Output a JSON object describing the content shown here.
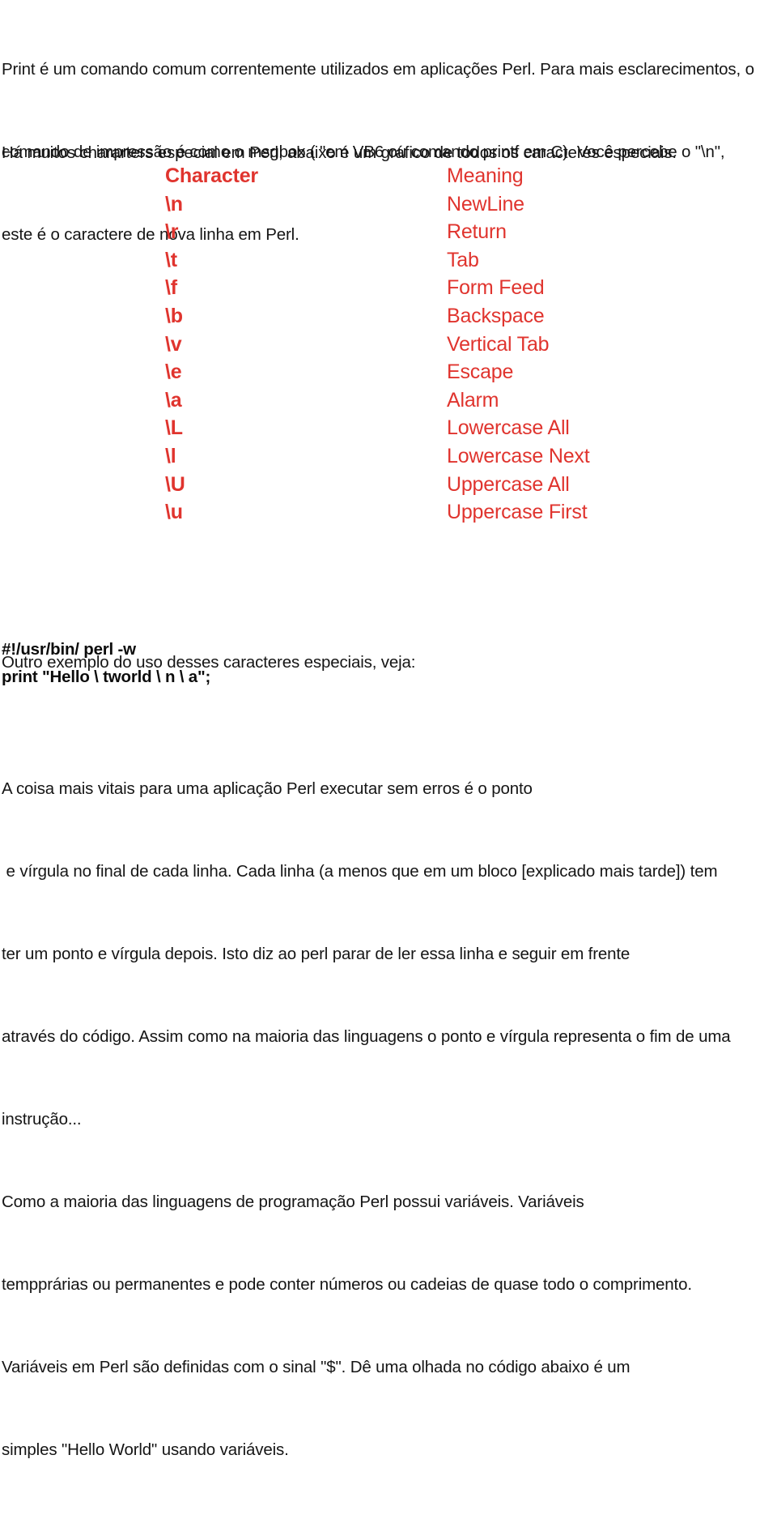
{
  "document": {
    "language": "pt-BR",
    "accent_color": "#e0342e",
    "text_color": "#151515"
  },
  "intro_paragraph": {
    "lines": [
      "Print é um comando comum correntemente utilizados em aplicações Perl. Para mais esclarecimentos, o",
      "comando de impressão é como o msgbox ( \"em VB6 ou comando printf em C). Você percebe o \"\\n\",",
      "este é o caractere de nova linha em Perl."
    ]
  },
  "chart_lead_paragraph": {
    "lines": [
      "Há muitos chararters especial em Perl, abaixo é um gráfico de todos os caracteres especiais."
    ]
  },
  "special_chars_table": {
    "headers": {
      "character": "Character",
      "meaning": "Meaning"
    },
    "rows": [
      {
        "character": "\\n",
        "meaning": "NewLine"
      },
      {
        "character": "\\r",
        "meaning": "Return"
      },
      {
        "character": "\\t",
        "meaning": "Tab"
      },
      {
        "character": "\\f",
        "meaning": "Form Feed"
      },
      {
        "character": "\\b",
        "meaning": "Backspace"
      },
      {
        "character": "\\v",
        "meaning": "Vertical Tab"
      },
      {
        "character": "\\e",
        "meaning": "Escape"
      },
      {
        "character": "\\a",
        "meaning": "Alarm"
      },
      {
        "character": "\\L",
        "meaning": "Lowercase All"
      },
      {
        "character": "\\l",
        "meaning": "Lowercase Next"
      },
      {
        "character": "\\U",
        "meaning": "Uppercase All"
      },
      {
        "character": "\\u",
        "meaning": "Uppercase First"
      }
    ]
  },
  "example_lead": {
    "lines": [
      "Outro exemplo do uso desses caracteres especiais, veja:"
    ]
  },
  "code_block": {
    "lines": [
      "#!/usr/bin/ perl -w",
      "print \"Hello \\ tworld \\ n \\ a\";"
    ]
  },
  "closing_paragraph": {
    "lines": [
      "A coisa mais vitais para uma aplicação Perl executar sem erros é o ponto",
      " e vírgula no final de cada linha. Cada linha (a menos que em um bloco [explicado mais tarde]) tem",
      "ter um ponto e vírgula depois. Isto diz ao perl parar de ler essa linha e seguir em frente",
      "através do código. Assim como na maioria das linguagens o ponto e vírgula representa o fim de uma",
      "instrução...",
      "Como a maioria das linguagens de programação Perl possui variáveis. Variáveis",
      "tempprárias ou permanentes e pode conter números ou cadeias de quase todo o comprimento.",
      "Variáveis em Perl são definidas com o sinal \"$\". Dê uma olhada no código abaixo é um",
      "simples \"Hello World\" usando variáveis."
    ]
  }
}
